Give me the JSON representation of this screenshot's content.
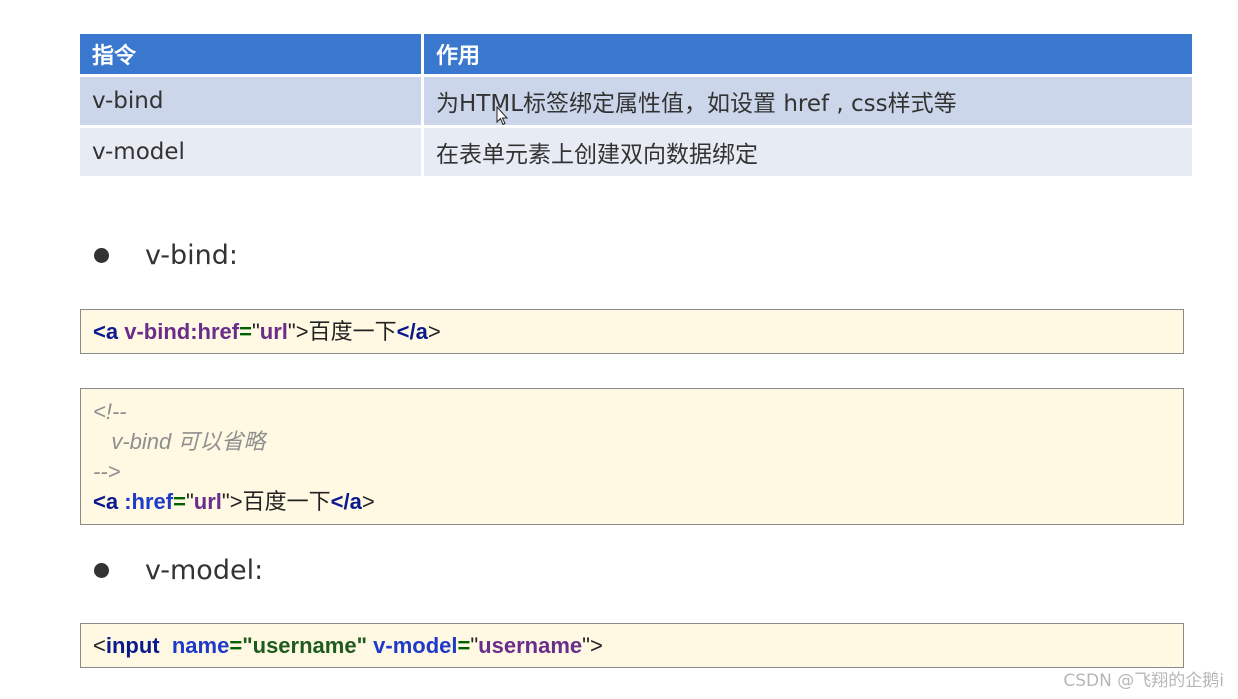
{
  "table": {
    "headers": [
      "指令",
      "作用"
    ],
    "rows": [
      {
        "directive": "v-bind",
        "purpose": "为HTML标签绑定属性值，如设置 href , css样式等"
      },
      {
        "directive": "v-model",
        "purpose": "在表单元素上创建双向数据绑定"
      }
    ]
  },
  "bullets": {
    "bind": "v-bind:",
    "model": "v-model:"
  },
  "code1": {
    "lt": "<",
    "tag_a": "a",
    "attr": "v-bind:href",
    "eq": "=",
    "q1": "\"",
    "val": "url",
    "q2": "\"",
    "gt": ">",
    "text": "百度一下",
    "close_lt": "</",
    "close_tag": "a",
    "close_gt": ">"
  },
  "code2": {
    "comment_open": "<!--",
    "comment_body": "   v-bind 可以省略",
    "comment_close": "-->",
    "lt": "<",
    "tag_a": "a",
    "attr": ":href",
    "eq": "=",
    "q1": "\"",
    "val": "url",
    "q2": "\"",
    "gt": ">",
    "text": "百度一下",
    "close_lt": "</",
    "close_tag": "a",
    "close_gt": ">"
  },
  "code3": {
    "lt": "<",
    "tag": "input",
    "attr1": "name",
    "eq1": "=",
    "val1": "\"username\"",
    "attr2": "v-model",
    "eq2": "=",
    "q_open": "\"",
    "val2": "username",
    "q_close": "\"",
    "gt": ">"
  },
  "watermark": "CSDN @飞翔的企鹅i"
}
